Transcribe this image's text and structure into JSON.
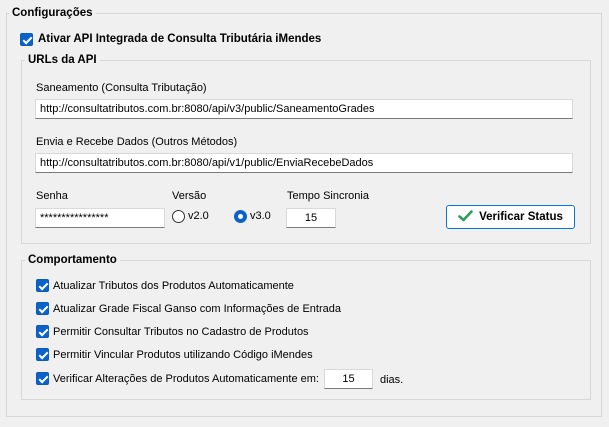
{
  "config_group": {
    "title": "Configurações",
    "enable_api_label": "Ativar API Integrada de Consulta Tributária iMendes",
    "enable_api_checked": true
  },
  "urls_group": {
    "title": "URLs da API",
    "saneamento_label": "Saneamento (Consulta Tributação)",
    "saneamento_value": "http://consultatributos.com.br:8080/api/v3/public/SaneamentoGrades",
    "envia_label": "Envia e Recebe Dados (Outros Métodos)",
    "envia_value": "http://consultatributos.com.br:8080/api/v1/public/EnviaRecebeDados",
    "senha_label": "Senha",
    "senha_value": "****************",
    "versao_label": "Versão",
    "versao_options": [
      "v2.0",
      "v3.0"
    ],
    "versao_selected": "v3.0",
    "tempo_label": "Tempo Sincronia",
    "tempo_value": "15",
    "verify_button_label": "Verificar Status"
  },
  "behavior_group": {
    "title": "Comportamento",
    "options": [
      {
        "label": "Atualizar Tributos dos Produtos Automaticamente",
        "checked": true
      },
      {
        "label": "Atualizar Grade Fiscal Ganso com Informações de Entrada",
        "checked": true
      },
      {
        "label": "Permitir Consultar Tributos no Cadastro de Produtos",
        "checked": true
      },
      {
        "label": "Permitir Vincular Produtos utilizando Código iMendes",
        "checked": true
      },
      {
        "label": "Verificar Alterações de Produtos Automaticamente em:",
        "checked": true
      }
    ],
    "days_value": "15",
    "days_unit": "dias."
  },
  "colors": {
    "accent": "#0b63c9",
    "success_icon": "#2e9d5a",
    "button_border": "#0078d4"
  },
  "icons": {
    "verify_button_icon": "check-icon"
  }
}
